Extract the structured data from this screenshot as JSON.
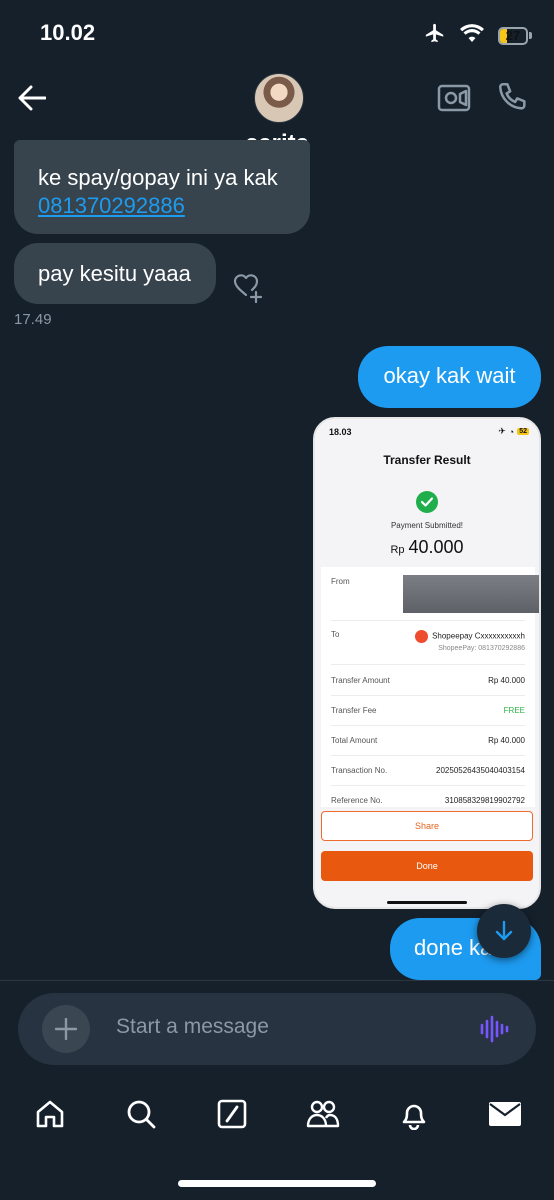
{
  "status_bar": {
    "time": "10.02",
    "battery": "27",
    "battery_level": 0.27
  },
  "header": {
    "contact_name": "carita"
  },
  "messages": {
    "incoming_1": {
      "text": "ke spay/gopay ini ya kak",
      "link": "081370292886"
    },
    "incoming_2": {
      "text": "pay kesitu yaaa"
    },
    "incoming_time": "17.49",
    "outgoing_1": {
      "text": "okay kak wait"
    },
    "outgoing_2": {
      "text": "done kak"
    }
  },
  "attachment": {
    "status_time": "18.03",
    "battery": "52",
    "title": "Transfer Result",
    "status_text": "Payment Submitted!",
    "currency": "Rp",
    "amount": "40.000",
    "rows": [
      {
        "label": "From",
        "value": ""
      },
      {
        "label": "To",
        "value": "Shopeepay Cxxxxxxxxxxh",
        "sub": "ShopeePay: 081370292886"
      },
      {
        "label": "Transfer Amount",
        "value": "Rp 40.000"
      },
      {
        "label": "Transfer Fee",
        "value": "FREE"
      },
      {
        "label": "Total Amount",
        "value": "Rp 40.000"
      },
      {
        "label": "Transaction No.",
        "value": "20250526435040403154"
      },
      {
        "label": "Reference No.",
        "value": "310858329819902792"
      }
    ],
    "share_label": "Share",
    "done_label": "Done"
  },
  "composer": {
    "placeholder": "Start a message"
  },
  "nav": {
    "items": [
      "home-icon",
      "search-icon",
      "compose-icon",
      "communities-icon",
      "notifications-icon",
      "messages-icon"
    ]
  },
  "colors": {
    "background": "#15202b",
    "accent": "#1d9bf0",
    "incoming_bubble": "#38444d",
    "voice_accent": "#7856ff"
  }
}
